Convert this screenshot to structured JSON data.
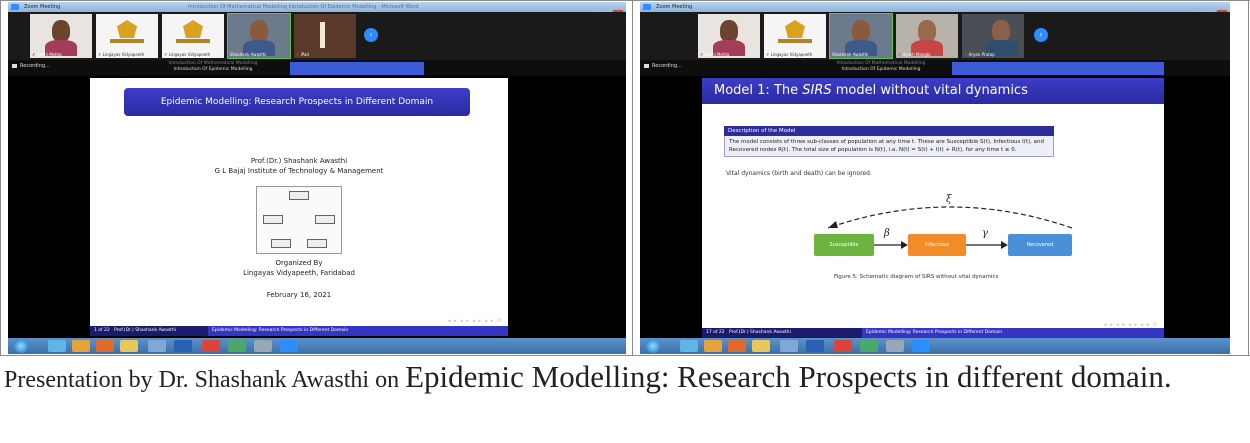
{
  "left_window": {
    "title": "Zoom Meeting",
    "window_caption": "Introduction Of Mathematical Modelling Introduction Of Epidemic Modelling - Microsoft Word",
    "participants": [
      {
        "name": "Jyothi Mehta",
        "type": "person"
      },
      {
        "name": "Lingayas Vidyapeeth",
        "type": "logo"
      },
      {
        "name": "Lingayas Vidyapeeth",
        "type": "logo"
      },
      {
        "name": "Shashank Awasthi",
        "type": "person"
      },
      {
        "name": "iPad",
        "type": "bar"
      }
    ],
    "recording_label": "Recording...",
    "breadcrumb_top": "Introduction Of Mathematical Modelling",
    "breadcrumb_bottom": "Introduction Of Epidemic Modelling",
    "slide": {
      "title": "Epidemic Modelling: Research Prospects in Different Domain",
      "author": "Prof.(Dr.) Shashank Awasthi",
      "institute": "G L Bajaj Institute of Technology & Management",
      "organized_label": "Organized By",
      "organizer": "Lingayas Vidyapeeth, Faridabad",
      "date": "February 16, 2021"
    },
    "footer": {
      "page": "1 of 22",
      "author": "Prof.(Dr.) Shashank Awasthi",
      "title": "Epidemic Modelling: Research Prospects in Different Domain"
    }
  },
  "right_window": {
    "title": "Zoom Meeting",
    "participants": [
      {
        "name": "Kunhi Mehta",
        "type": "person"
      },
      {
        "name": "Lingayas Vidyapeeth",
        "type": "logo"
      },
      {
        "name": "Shashank Awasthi",
        "type": "person"
      },
      {
        "name": "Ayush Mangla",
        "type": "person"
      },
      {
        "name": "Aryan Pratap",
        "type": "person"
      }
    ],
    "recording_label": "Recording...",
    "breadcrumb_top": "Introduction Of Mathematical Modelling",
    "breadcrumb_bottom": "Introduction Of Epidemic Modelling",
    "slide": {
      "title_prefix": "Model 1: The ",
      "title_italic": "SIRS",
      "title_suffix": " model without vital dynamics",
      "block_title": "Description of the Model",
      "block_text": "The model consists of three sub-classes of population at any time t. These are Susceptible S(t), Infectious I(t), and Recovered nodes R(t). The total size of population is N(t), i.e. N(t) = S(t) + I(t) + R(t), for any time t ≥ 0.",
      "vital_note": "Vital dynamics (birth and death) can be ignored.",
      "nodes": [
        "Susceptible",
        "Infectious",
        "Recovered"
      ],
      "beta": "β",
      "gamma": "γ",
      "xi": "ξ",
      "caption": "Figure 5: Schematic diagram of SIRS without vital dynamics"
    },
    "footer": {
      "page": "17 of 22",
      "author": "Prof.(Dr.) Shashank Awasthi",
      "title": "Epidemic Modelling: Research Prospects in Different Domain"
    }
  },
  "caption": {
    "prefix": "Presentation by Dr. Shashank Awasthi on ",
    "emphasis": "Epidemic Modelling: Research Prospects in different domain."
  },
  "colors": {
    "zoom_blue": "#2d8cff",
    "beamer_blue": "#3d3dc8",
    "susceptible": "#6db33f",
    "infectious": "#f28c28",
    "recovered": "#4a90d9"
  }
}
